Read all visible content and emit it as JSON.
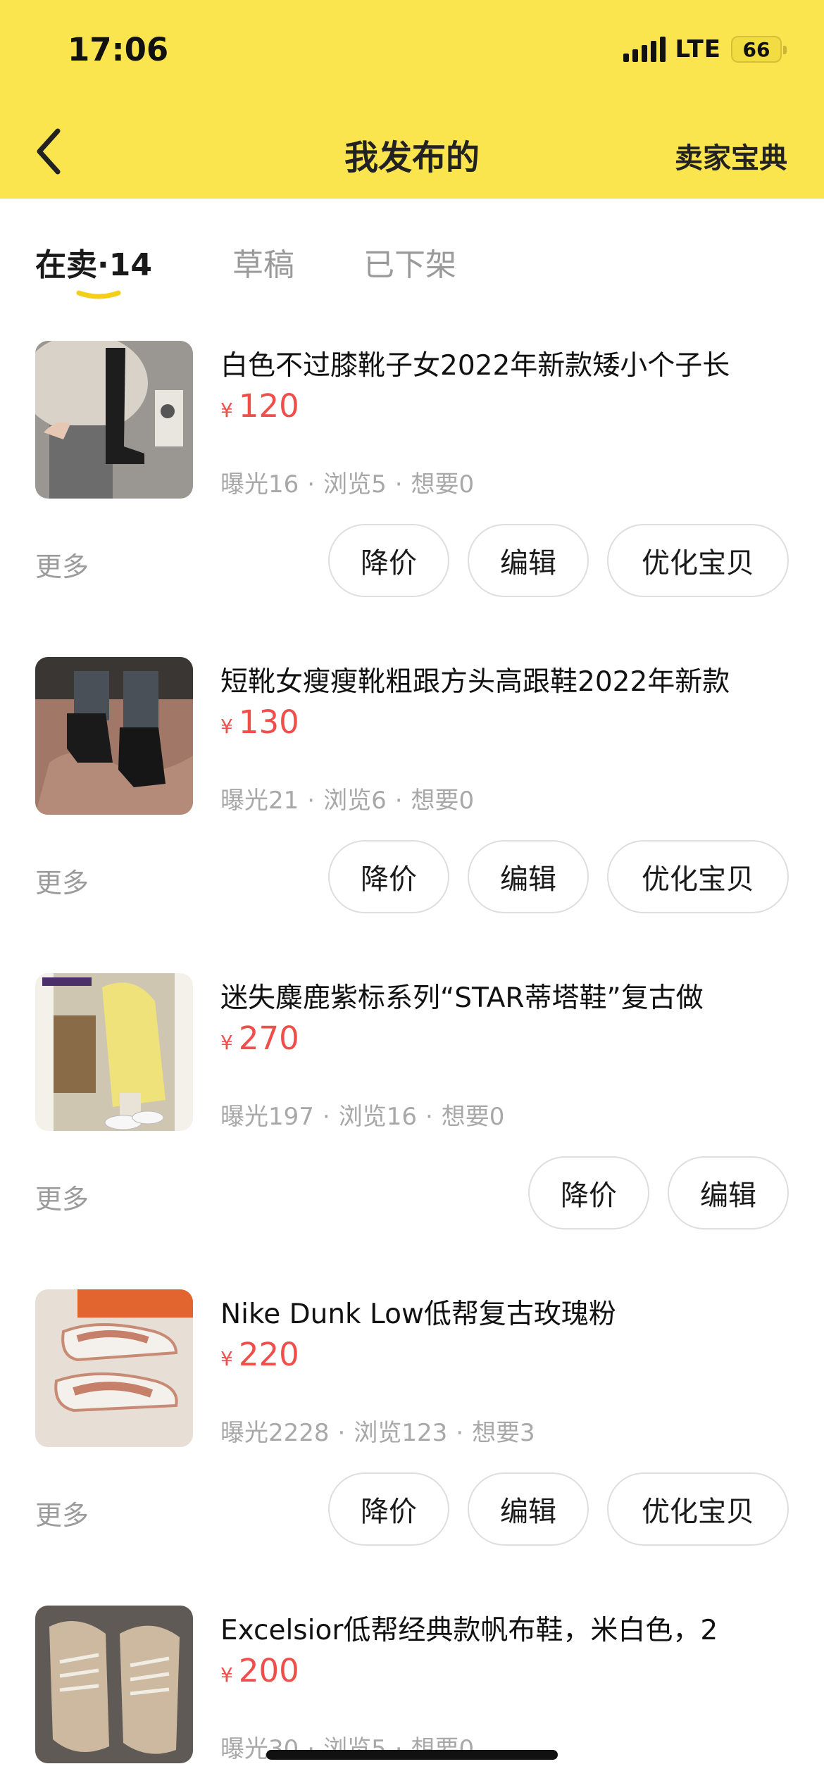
{
  "status": {
    "time": "17:06",
    "network": "LTE",
    "battery": "66"
  },
  "nav": {
    "title": "我发布的",
    "right_label": "卖家宝典"
  },
  "tabs": [
    {
      "label": "在卖",
      "count": "14"
    },
    {
      "label": "草稿"
    },
    {
      "label": "已下架"
    }
  ],
  "currency": "¥",
  "labels": {
    "more": "更多",
    "reduce_price": "降价",
    "edit": "编辑",
    "optimize": "优化宝贝"
  },
  "items": [
    {
      "title": "白色不过膝靴子女2022年新款矮小个子长",
      "price": "120",
      "exposure": "曝光16",
      "views": "浏览5",
      "wants": "想要0"
    },
    {
      "title": "短靴女瘦瘦靴粗跟方头高跟鞋2022年新款",
      "price": "130",
      "exposure": "曝光21",
      "views": "浏览6",
      "wants": "想要0"
    },
    {
      "title": "迷失麋鹿紫标系列“STAR蒂塔鞋”复古做",
      "price": "270",
      "exposure": "曝光197",
      "views": "浏览16",
      "wants": "想要0"
    },
    {
      "title": "Nike Dunk Low低帮复古玫瑰粉",
      "price": "220",
      "exposure": "曝光2228",
      "views": "浏览123",
      "wants": "想要3"
    },
    {
      "title": "Excelsior低帮经典款帆布鞋，米白色，2",
      "price": "200",
      "exposure": "曝光30",
      "views": "浏览5",
      "wants": "想要0"
    }
  ],
  "colors": {
    "header_bg": "#fbe54f",
    "price": "#ef4e4a",
    "tab_underline": "#f3cf1a"
  }
}
